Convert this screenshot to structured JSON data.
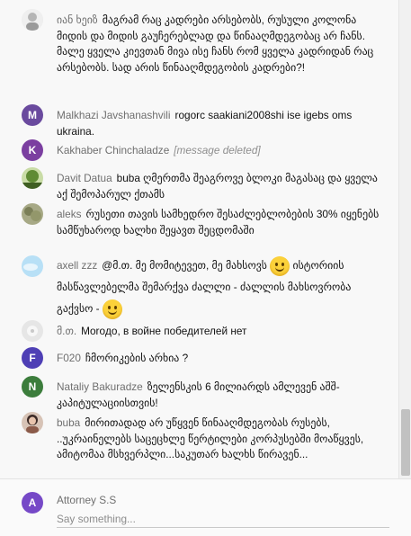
{
  "messages": [
    {
      "author": "იან ხეიზ",
      "text": "მაგრამ რაც კადრები არსებობს, რუსული კოლონა მიდის და მიდის გაუჩერებლად და წინააღმდეგობაც არ ჩანს. მალე ყველა კიევთან მივა ისე ჩანს რომ ყველა კადრიდან რაც არსებობს. სად არის წინააღმდეგობის კადრები?!",
      "avatar_letter": "",
      "avatar_color": "#d9d9d9",
      "avatar_icon": "person-photo-icon"
    },
    {
      "author": "Malkhazi Javshanashvili",
      "text": "rogorc saakiani2008shi ise igebs oms ukraina.",
      "avatar_letter": "M",
      "avatar_color": "#6a4a9e"
    },
    {
      "author": "Kakhaber Chinchaladze",
      "text": "[message deleted]",
      "avatar_letter": "K",
      "avatar_color": "#7b3fa0"
    },
    {
      "author": "Davit Datua",
      "text": "buba ღმერთმა შეაგროვე ბლოკი მაგასაც და ყველა აქ შემოპარულ ქთამს",
      "avatar_letter": "",
      "avatar_color": "#5c7a3a",
      "avatar_icon": "landscape-photo-icon"
    },
    {
      "author": "aleks",
      "text": "რუსეთი თავის სამხედრო შესაძლებლობების 30% იყენებს სამწუხაროდ ხალხი შეყავთ შეცდომაში",
      "avatar_letter": "",
      "avatar_color": "#8a8f6c",
      "avatar_icon": "plant-photo-icon"
    },
    {
      "author": "axell zzz",
      "text_before": "@მ.თ. მე მომიტევეთ, მე მახსოვს",
      "text_after": "ისტორიის მასწავლებელმა შემარქვა ძალლი - ძალლის მახსოვრობა გაქვსო -",
      "avatar_letter": "",
      "avatar_color": "#a9d6f0",
      "avatar_icon": "sky-photo-icon"
    },
    {
      "author": "მ.თ.",
      "text": "Moroдо, в войне победителей нет",
      "avatar_letter": "",
      "avatar_color": "#d8d8d8",
      "avatar_icon": "flower-photo-icon"
    },
    {
      "author": "F020",
      "text": "ჩმორიკების არხია ?",
      "avatar_letter": "F",
      "avatar_color": "#4e3fb5"
    },
    {
      "author": "Nataliy Bakuradze",
      "text": "ზელენსკის 6 მილიარდს ამლევენ აშშ- კაპიტულაციისთვის!",
      "avatar_letter": "N",
      "avatar_color": "#3c7d3c"
    },
    {
      "author": "buba",
      "text": "მირითადად არ უწყვენ წინააღმდეგობას რუსებს, ..უკრაინელებს საცეცხლე წერტილები კორპუსებში მოაწყვეს, ამიტომაა მსხვერპლი...საკუთარ ხალხს წირავენ...",
      "avatar_letter": "",
      "avatar_color": "#b88d7a",
      "avatar_icon": "woman-photo-icon"
    }
  ],
  "footer": {
    "author": "Attorney S.S",
    "avatar_letter": "A",
    "avatar_color": "#7649c7",
    "placeholder": "Say something..."
  }
}
